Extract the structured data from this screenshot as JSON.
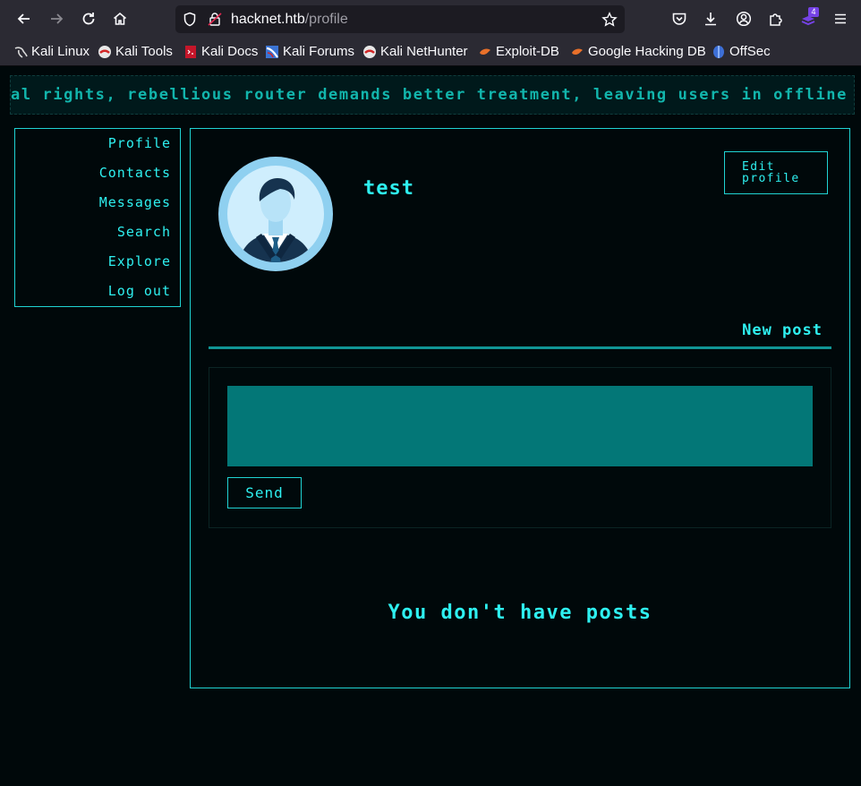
{
  "browser": {
    "url_host": "hacknet.htb",
    "url_path": "/profile",
    "extensions_badge": "4",
    "bookmarks": [
      {
        "label": "Kali Linux"
      },
      {
        "label": "Kali Tools"
      },
      {
        "label": "Kali Docs"
      },
      {
        "label": "Kali Forums"
      },
      {
        "label": "Kali NetHunter"
      },
      {
        "label": "Exploit-DB"
      },
      {
        "label": "Google Hacking DB"
      },
      {
        "label": "OffSec"
      }
    ]
  },
  "marquee": {
    "text": "al rights, rebellious router demands better treatment, leaving users in offline limbo."
  },
  "sidebar": {
    "items": [
      {
        "label": "Profile"
      },
      {
        "label": "Contacts"
      },
      {
        "label": "Messages"
      },
      {
        "label": "Search"
      },
      {
        "label": "Explore"
      },
      {
        "label": "Log out"
      }
    ]
  },
  "profile": {
    "username": "test",
    "edit_label_line1": "Edit",
    "edit_label_line2": "profile"
  },
  "new_post": {
    "label": "New post",
    "send_label": "Send"
  },
  "posts": {
    "empty_message": "You don't have posts"
  },
  "colors": {
    "accent": "#2ef0f0",
    "border": "#20d3d3",
    "textarea": "#037777",
    "background": "#00080a"
  }
}
